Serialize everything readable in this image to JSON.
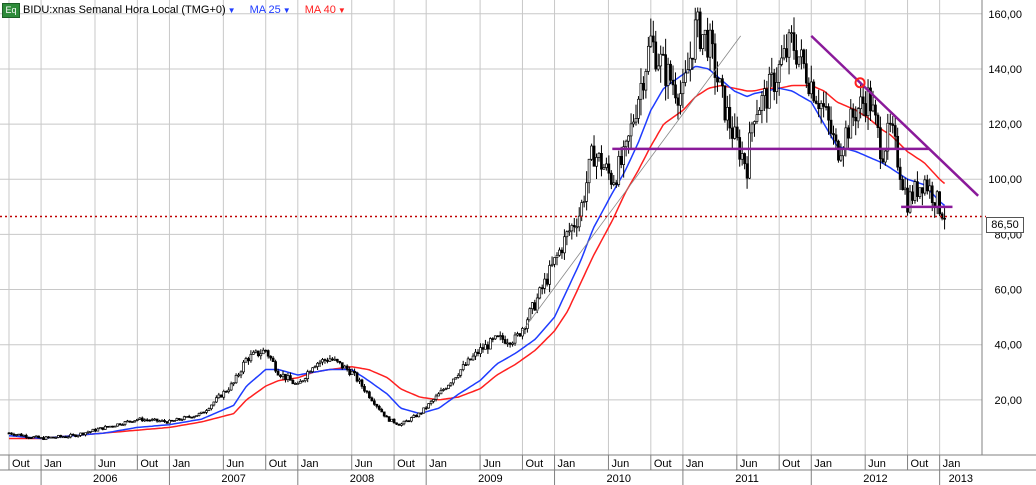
{
  "header": {
    "badge": "Eq",
    "symbol": "BIDU:xnas Semanal Hora Local (TMG+0)",
    "ma25_label": "MA 25",
    "ma40_label": "MA 40",
    "dropdown_icon": "triangle-down-icon"
  },
  "colors": {
    "candle": "#000000",
    "ma25": "#1f3cff",
    "ma40": "#ff2020",
    "trendlines": "#8a1a9a",
    "price_line": "#c00000",
    "grid": "#c8c8c8"
  },
  "last_price_label": "86,50",
  "chart_data": {
    "type": "line",
    "title": "BIDU:xnas Semanal Hora Local (TMG+0)",
    "xlabel": "",
    "ylabel": "",
    "ylim": [
      0,
      165
    ],
    "grid": true,
    "legend": "top-left",
    "y_ticks": [
      20,
      40,
      60,
      80,
      100,
      120,
      140,
      160
    ],
    "y_tick_labels": [
      "20,00",
      "40,00",
      "60,00",
      "80,00",
      "100,00",
      "120,00",
      "140,00",
      "160,00"
    ],
    "month_labels": [
      "Out",
      "Jan",
      "Jun",
      "Out",
      "Jan",
      "Jun",
      "Out",
      "Jan",
      "Jun",
      "Out",
      "Jan",
      "Jun",
      "Out",
      "Jan",
      "Jun",
      "Out",
      "Jan",
      "Jun",
      "Out",
      "Jan",
      "Jun",
      "Out",
      "Jan"
    ],
    "month_dates": [
      2005.75,
      2006.0,
      2006.42,
      2006.75,
      2007.0,
      2007.42,
      2007.75,
      2008.0,
      2008.42,
      2008.75,
      2009.0,
      2009.42,
      2009.75,
      2010.0,
      2010.42,
      2010.75,
      2011.0,
      2011.42,
      2011.75,
      2012.0,
      2012.42,
      2012.75,
      2013.0
    ],
    "year_labels": [
      "2006",
      "2007",
      "2008",
      "2009",
      "2010",
      "2011",
      "2012",
      "2013"
    ],
    "x": [
      2005.75,
      2006.0,
      2006.25,
      2006.5,
      2006.75,
      2007.0,
      2007.25,
      2007.5,
      2007.6,
      2007.75,
      2007.85,
      2008.0,
      2008.12,
      2008.25,
      2008.42,
      2008.55,
      2008.7,
      2008.8,
      2008.95,
      2009.1,
      2009.25,
      2009.42,
      2009.55,
      2009.7,
      2009.85,
      2010.0,
      2010.1,
      2010.2,
      2010.3,
      2010.45,
      2010.55,
      2010.65,
      2010.75,
      2010.85,
      2011.0,
      2011.1,
      2011.2,
      2011.3,
      2011.4,
      2011.5,
      2011.55,
      2011.65,
      2011.75,
      2011.85,
      2012.0,
      2012.1,
      2012.2,
      2012.35,
      2012.45,
      2012.55,
      2012.62,
      2012.75,
      2012.88,
      2013.0,
      2013.05
    ],
    "series": [
      {
        "name": "BIDU:xnas",
        "values": [
          8,
          6,
          7,
          10,
          13,
          12,
          15,
          26,
          35,
          38,
          30,
          25,
          33,
          35,
          30,
          22,
          13,
          11,
          15,
          22,
          30,
          38,
          42,
          42,
          55,
          70,
          80,
          88,
          110,
          100,
          108,
          130,
          150,
          140,
          130,
          155,
          150,
          130,
          115,
          105,
          125,
          130,
          140,
          150,
          135,
          125,
          110,
          125,
          130,
          110,
          118,
          92,
          100,
          90,
          86.5
        ]
      },
      {
        "name": "MA 25",
        "values": [
          7,
          6,
          7,
          8,
          10,
          11,
          13,
          18,
          25,
          31,
          31,
          29,
          30,
          31,
          31,
          27,
          22,
          17,
          15,
          17,
          22,
          27,
          33,
          37,
          42,
          50,
          60,
          70,
          82,
          95,
          103,
          113,
          125,
          133,
          138,
          141,
          140,
          136,
          132,
          130,
          131,
          132,
          133,
          132,
          128,
          120,
          112,
          110,
          108,
          106,
          104,
          100,
          98,
          92,
          90
        ]
      },
      {
        "name": "MA 40",
        "values": [
          6,
          6,
          7,
          8,
          9,
          10,
          12,
          15,
          20,
          25,
          27,
          28,
          30,
          31,
          32,
          31,
          28,
          24,
          21,
          20,
          21,
          24,
          29,
          33,
          38,
          45,
          52,
          62,
          72,
          85,
          95,
          103,
          112,
          120,
          125,
          130,
          133,
          134,
          133,
          132,
          132,
          133,
          133,
          134,
          134,
          132,
          128,
          125,
          122,
          118,
          116,
          110,
          106,
          100,
          98
        ]
      }
    ],
    "annotations": {
      "horizontal_line": 111,
      "support_line": 90,
      "last_price": 86.5,
      "resistance_line_from": [
        2012.0,
        152
      ],
      "resistance_line_to": [
        2013.3,
        94
      ],
      "circle_marker": [
        2012.38,
        135
      ]
    }
  }
}
